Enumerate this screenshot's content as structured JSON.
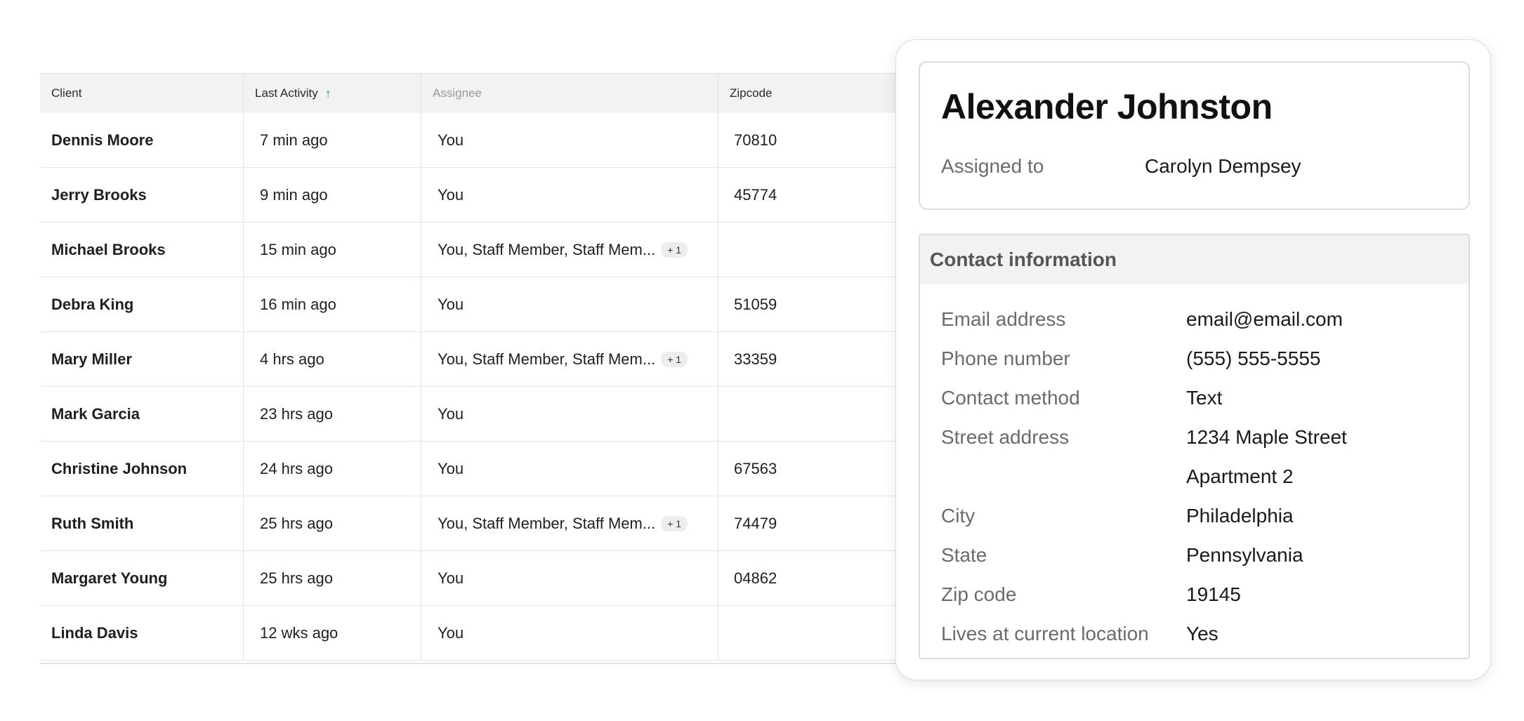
{
  "table": {
    "headers": {
      "client": "Client",
      "last_activity": "Last Activity",
      "assignee": "Assignee",
      "zipcode": "Zipcode"
    },
    "sort_icon": "arrow-up-icon",
    "rows": [
      {
        "client": "Dennis Moore",
        "activity": "7 min ago",
        "assignee": "You",
        "extra": "",
        "zip": "70810"
      },
      {
        "client": "Jerry Brooks",
        "activity": "9 min ago",
        "assignee": "You",
        "extra": "",
        "zip": "45774"
      },
      {
        "client": "Michael Brooks",
        "activity": "15 min ago",
        "assignee": "You, Staff Member, Staff Mem...",
        "extra": "+ 1",
        "zip": ""
      },
      {
        "client": "Debra King",
        "activity": "16 min ago",
        "assignee": "You",
        "extra": "",
        "zip": "51059"
      },
      {
        "client": "Mary Miller",
        "activity": "4 hrs ago",
        "assignee": "You, Staff Member, Staff Mem...",
        "extra": "+ 1",
        "zip": "33359"
      },
      {
        "client": "Mark Garcia",
        "activity": "23 hrs ago",
        "assignee": "You",
        "extra": "",
        "zip": ""
      },
      {
        "client": "Christine Johnson",
        "activity": "24 hrs ago",
        "assignee": "You",
        "extra": "",
        "zip": "67563"
      },
      {
        "client": "Ruth Smith",
        "activity": "25 hrs ago",
        "assignee": "You, Staff Member, Staff Mem...",
        "extra": "+ 1",
        "zip": "74479"
      },
      {
        "client": "Margaret Young",
        "activity": "25 hrs ago",
        "assignee": "You",
        "extra": "",
        "zip": "04862"
      },
      {
        "client": "Linda Davis",
        "activity": "12 wks ago",
        "assignee": "You",
        "extra": "",
        "zip": ""
      }
    ]
  },
  "detail": {
    "name": "Alexander Johnston",
    "assigned_label": "Assigned to",
    "assigned_value": "Carolyn Dempsey",
    "contact_header": "Contact information",
    "contact": {
      "email_label": "Email address",
      "email": "email@email.com",
      "phone_label": "Phone number",
      "phone": "(555) 555-5555",
      "method_label": "Contact method",
      "method": "Text",
      "street_label": "Street address",
      "street1": "1234 Maple Street",
      "street2": "Apartment 2",
      "city_label": "City",
      "city": "Philadelphia",
      "state_label": "State",
      "state": "Pennsylvania",
      "zip_label": "Zip code",
      "zip": "19145",
      "lives_label": "Lives at current location",
      "lives": "Yes"
    }
  },
  "colors": {
    "accent": "#1aa18a"
  }
}
